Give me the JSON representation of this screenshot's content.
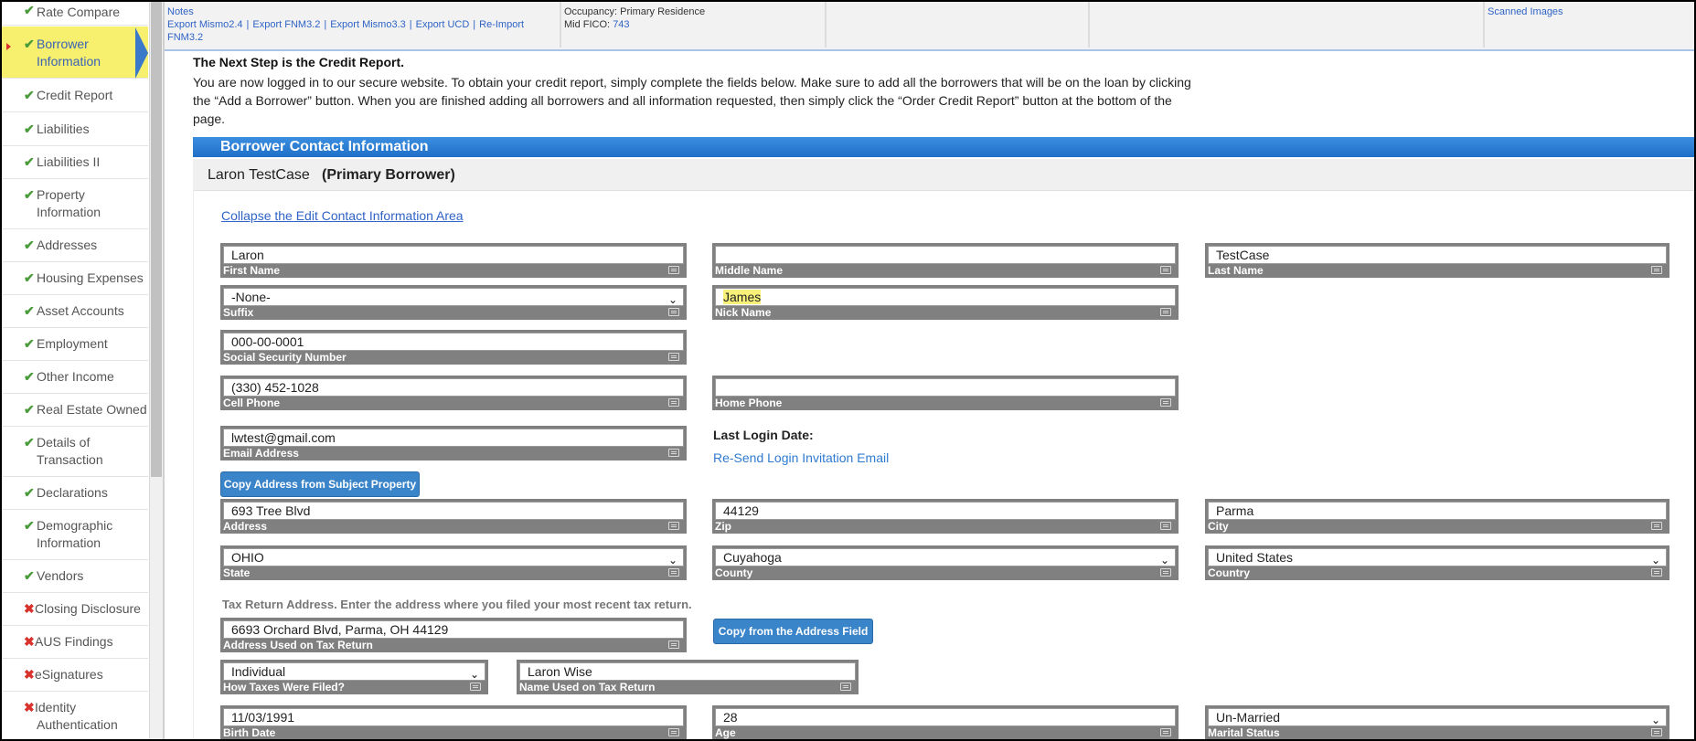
{
  "sidebar": {
    "items": [
      {
        "label": "Rate Compare",
        "status": "ok"
      },
      {
        "label": "Borrower Information",
        "status": "ok"
      },
      {
        "label": "Credit Report",
        "status": "ok"
      },
      {
        "label": "Liabilities",
        "status": "ok"
      },
      {
        "label": "Liabilities II",
        "status": "ok"
      },
      {
        "label": "Property Information",
        "status": "ok"
      },
      {
        "label": "Addresses",
        "status": "ok"
      },
      {
        "label": "Housing Expenses",
        "status": "ok"
      },
      {
        "label": "Asset Accounts",
        "status": "ok"
      },
      {
        "label": "Employment",
        "status": "ok"
      },
      {
        "label": "Other Income",
        "status": "ok"
      },
      {
        "label": "Real Estate Owned",
        "status": "ok"
      },
      {
        "label": "Details of Transaction",
        "status": "ok"
      },
      {
        "label": "Declarations",
        "status": "ok"
      },
      {
        "label": "Demographic Information",
        "status": "ok"
      },
      {
        "label": "Vendors",
        "status": "ok"
      },
      {
        "label": "Closing Disclosure",
        "status": "bad"
      },
      {
        "label": "AUS Findings",
        "status": "bad"
      },
      {
        "label": "eSignatures",
        "status": "bad"
      },
      {
        "label": "Identity Authentication",
        "status": "bad"
      }
    ]
  },
  "header": {
    "notes": "Notes",
    "export_links": [
      "Export Mismo2.4",
      "Export FNM3.2",
      "Export Mismo3.3",
      "Export UCD",
      "Re-Import FNM3.2"
    ],
    "occupancy_label": "Occupancy:",
    "occupancy_value": "Primary Residence",
    "mid_fico_label": "Mid FICO:",
    "mid_fico_value": "743",
    "scanned_images": "Scanned Images"
  },
  "intro": {
    "title": "The Next Step is the Credit Report.",
    "text": "You are now logged in to our secure website. To obtain your credit report, simply complete the fields below. Make sure to add all the borrowers that will be on the loan by clicking the “Add a Borrower” button. When you are finished adding all borrowers and all information requested, then simply click the “Order Credit Report” button at the bottom of the page."
  },
  "section": {
    "title": "Borrower Contact Information",
    "borrower_name": "Laron TestCase",
    "borrower_role": "(Primary Borrower)",
    "collapse_link": "Collapse the Edit Contact Information Area"
  },
  "fields": {
    "first_name": {
      "label": "First Name",
      "value": "Laron"
    },
    "middle_name": {
      "label": "Middle Name",
      "value": ""
    },
    "last_name": {
      "label": "Last Name",
      "value": "TestCase"
    },
    "suffix": {
      "label": "Suffix",
      "value": "-None-"
    },
    "nick_name": {
      "label": "Nick Name",
      "value": "James"
    },
    "ssn": {
      "label": "Social Security Number",
      "value": "000-00-0001"
    },
    "cell_phone": {
      "label": "Cell Phone",
      "value": "(330) 452-1028"
    },
    "home_phone": {
      "label": "Home Phone",
      "value": ""
    },
    "email": {
      "label": "Email Address",
      "value": "lwtest@gmail.com"
    },
    "address": {
      "label": "Address",
      "value": "693 Tree Blvd"
    },
    "zip": {
      "label": "Zip",
      "value": "44129"
    },
    "city": {
      "label": "City",
      "value": "Parma"
    },
    "state": {
      "label": "State",
      "value": "OHIO"
    },
    "county": {
      "label": "County",
      "value": "Cuyahoga"
    },
    "country": {
      "label": "Country",
      "value": "United States"
    },
    "tax_address": {
      "label": "Address Used on Tax Return",
      "value": "6693 Orchard Blvd, Parma, OH 44129"
    },
    "taxes_filed": {
      "label": "How Taxes Were Filed?",
      "value": "Individual"
    },
    "tax_name": {
      "label": "Name Used on Tax Return",
      "value": "Laron Wise"
    },
    "birth_date": {
      "label": "Birth Date",
      "value": "11/03/1991"
    },
    "age": {
      "label": "Age",
      "value": "28"
    },
    "marital_status": {
      "label": "Marital Status",
      "value": "Un-Married"
    }
  },
  "login": {
    "last_login_label": "Last Login Date:",
    "resend_link": "Re-Send Login Invitation Email"
  },
  "buttons": {
    "copy_address": "Copy Address from Subject Property",
    "copy_from_address": "Copy from the Address Field"
  },
  "tax_note": "Tax Return Address. Enter the address where you filed your most recent tax return.",
  "colors": {
    "accent": "#1f6fc7",
    "highlight": "#f7ef6e",
    "ok": "#4a9b3a",
    "bad": "#d9322c"
  }
}
